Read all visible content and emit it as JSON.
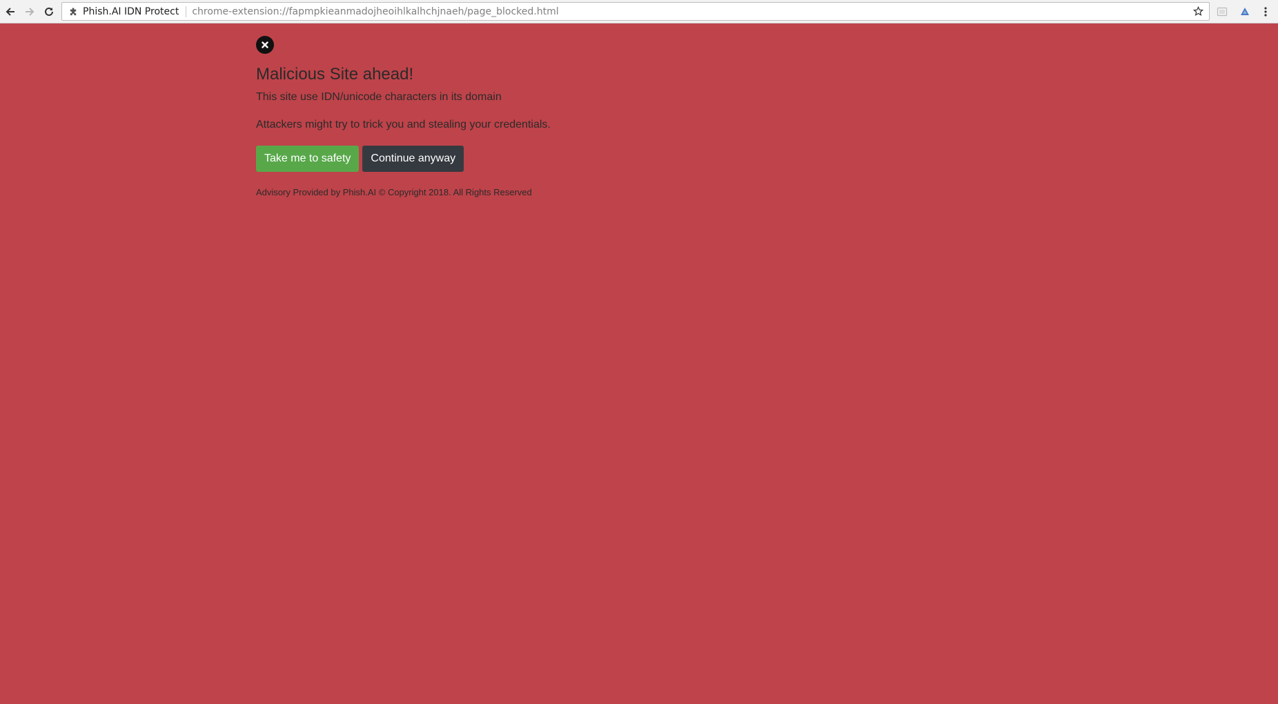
{
  "browser": {
    "site_name": "Phish.AI IDN Protect",
    "url": "chrome-extension://fapmpkieanmadojheoihlkalhchjnaeh/page_blocked.html",
    "icons": {
      "back": "back-arrow-icon",
      "forward": "forward-arrow-icon",
      "reload": "reload-icon",
      "extension": "puzzle-piece-icon",
      "bookmark": "star-icon",
      "ext1": "extension-icon",
      "ext2": "drive-icon",
      "menu": "kebab-menu-icon"
    }
  },
  "warning": {
    "heading": "Malicious Site ahead!",
    "description": "This site use IDN/unicode characters in its domain",
    "detail": "Attackers might try to trick you and stealing your credentials.",
    "safe_button": "Take me to safety",
    "continue_button": "Continue anyway",
    "footer": "Advisory Provided by Phish.AI © Copyright 2018. All Rights Reserved"
  },
  "colors": {
    "page_background": "#bf434a",
    "safe_button": "#58a84a",
    "continue_button": "#353a40"
  }
}
